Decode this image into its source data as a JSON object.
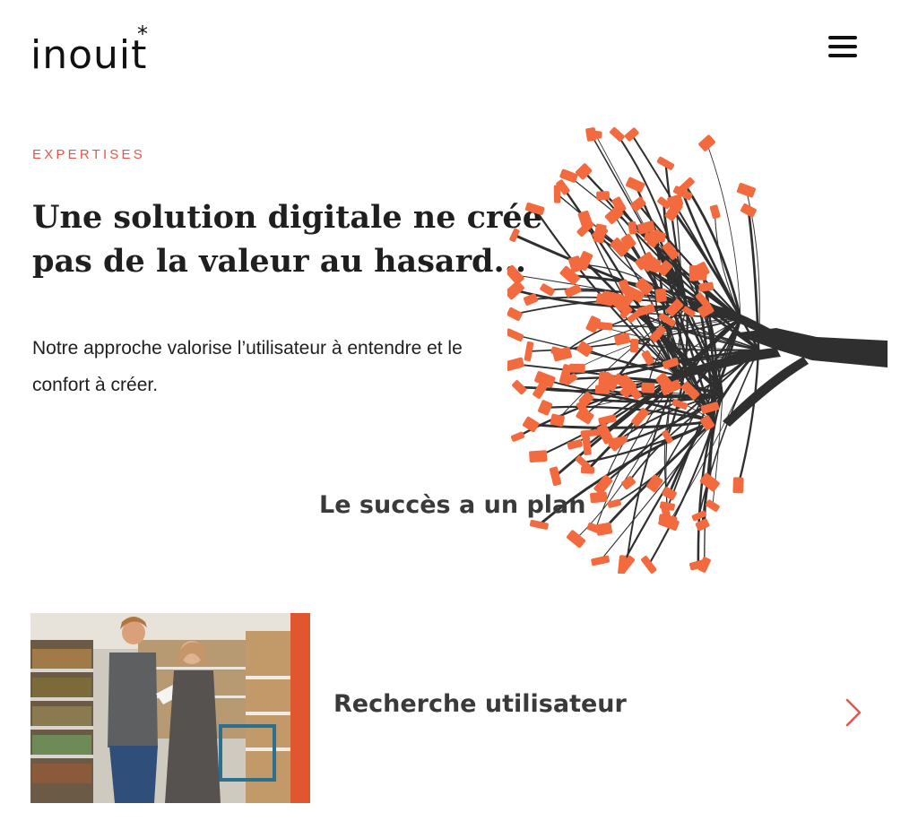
{
  "header": {
    "logo_text": "inouit",
    "logo_star": "*",
    "menu_icon": "hamburger-menu-icon"
  },
  "hero": {
    "eyebrow": "EXPERTISES",
    "headline": "Une solution digitale ne crée pas de la valeur au hasard...",
    "intro": "Notre approche valorise l’utilisateur à entendre et le confort à créer.",
    "tagline": "Le succès a un plan",
    "illustration": "tree-illustration",
    "colors": {
      "accent": "#f26a3d",
      "ink": "#2a2a2a",
      "eyebrow": "#e2574c"
    }
  },
  "card": {
    "title": "Recherche utilisateur",
    "image": "user-research-photo",
    "arrow_icon": "chevron-right-icon",
    "arrow_color": "#e2574c"
  }
}
